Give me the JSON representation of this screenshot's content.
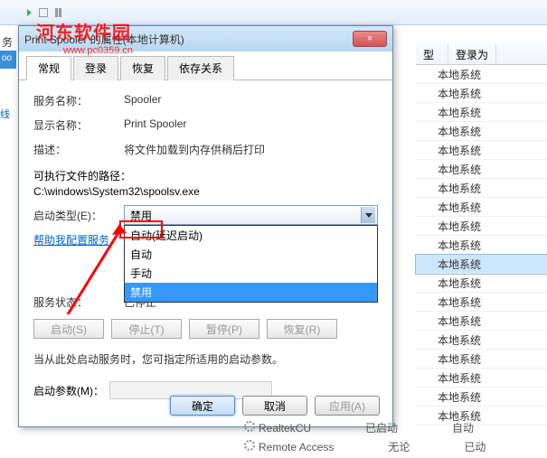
{
  "watermark": "河东软件园",
  "watermark_sub": "www.pc0359.cn",
  "toolbar": {
    "partial_text": "务"
  },
  "dialog": {
    "title": "Print Spooler 的属性(本地计算机)",
    "close": "×",
    "tabs": {
      "general": "常规",
      "logon": "登录",
      "recovery": "恢复",
      "deps": "依存关系"
    },
    "fields": {
      "svc_name_label": "服务名称：",
      "svc_name": "Spooler",
      "disp_name_label": "显示名称：",
      "disp_name": "Print Spooler",
      "desc_label": "描述：",
      "desc": "将文件加载到内存供稍后打印",
      "exe_label": "可执行文件的路径：",
      "exe_path": "C:\\windows\\System32\\spoolsv.exe",
      "startup_label": "启动类型(E)：",
      "startup_current": "禁用",
      "options": {
        "delayed": "自动(延迟启动)",
        "auto": "自动",
        "manual": "手动",
        "disabled": "禁用"
      },
      "help_link": "帮助我配置服务",
      "status_label": "服务状态：",
      "status": "已停止",
      "buttons": {
        "start": "启动(S)",
        "stop": "停止(T)",
        "pause": "暂停(P)",
        "resume": "恢复(R)"
      },
      "note": "当从此处启动服务时，您可指定所适用的启动参数。",
      "param_label": "启动参数(M)："
    },
    "footer": {
      "ok": "确定",
      "cancel": "取消",
      "apply": "应用(A)"
    }
  },
  "right": {
    "headers": {
      "col1": "型",
      "col2": "登录为"
    },
    "cell": "本地系统",
    "rows_count": 19,
    "highlight_index": 10
  },
  "bottom_services": {
    "r1": {
      "name": "RealtekCU",
      "status": "已启动",
      "type": "自动"
    },
    "r2": {
      "name": "Remote Access",
      "status": "无论",
      "type": "已动"
    }
  }
}
